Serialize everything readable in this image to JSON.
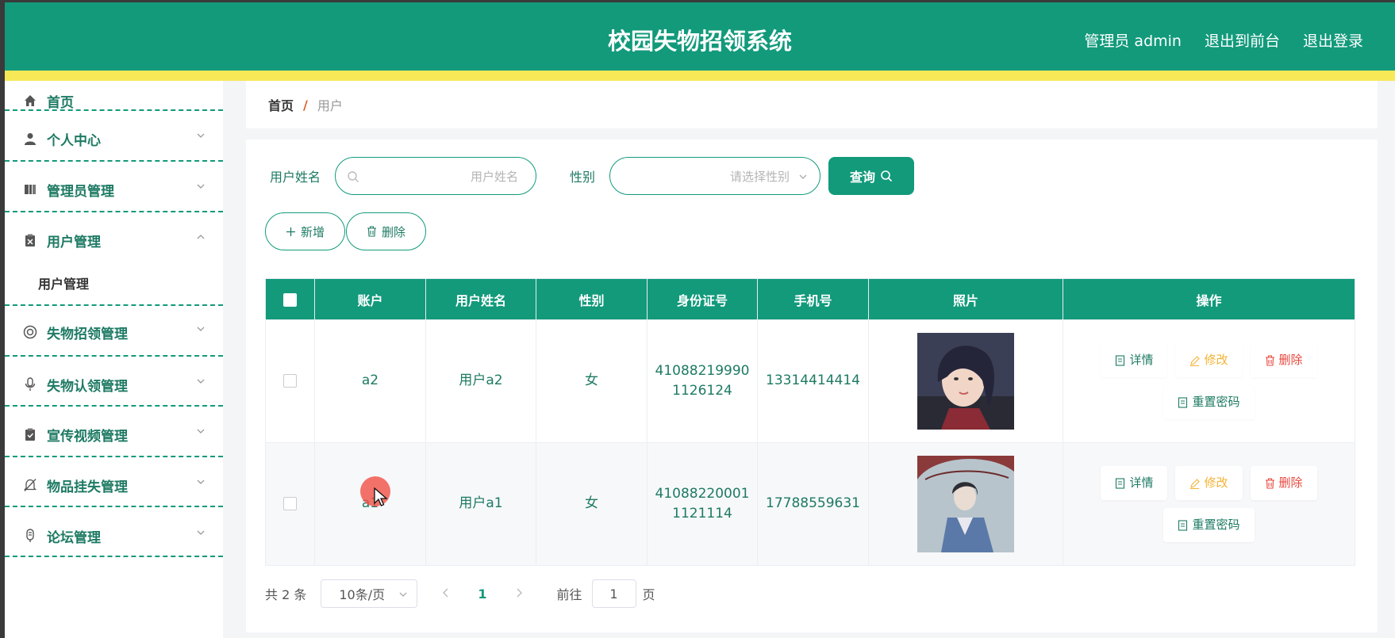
{
  "header": {
    "title": "校园失物招领系统",
    "admin_label": "管理员 admin",
    "to_front": "退出到前台",
    "logout": "退出登录"
  },
  "sidebar": {
    "items": [
      {
        "label": "首页",
        "icon": "home-icon"
      },
      {
        "label": "个人中心",
        "icon": "user-icon"
      },
      {
        "label": "管理员管理",
        "icon": "book-icon"
      },
      {
        "label": "用户管理",
        "icon": "clipboard-icon",
        "expanded": true
      },
      {
        "label": "失物招领管理",
        "icon": "lifebuoy-icon"
      },
      {
        "label": "失物认领管理",
        "icon": "microphone-icon"
      },
      {
        "label": "宣传视频管理",
        "icon": "clipboard-check-icon"
      },
      {
        "label": "物品挂失管理",
        "icon": "bell-off-icon"
      },
      {
        "label": "论坛管理",
        "icon": "mic-icon"
      }
    ],
    "subitem": "用户管理"
  },
  "breadcrumb": {
    "home": "首页",
    "sep": "/",
    "current": "用户"
  },
  "search": {
    "name_label": "用户姓名",
    "name_placeholder": "用户姓名",
    "gender_label": "性别",
    "gender_placeholder": "请选择性别",
    "query_button": "查询"
  },
  "actions": {
    "add": "新增",
    "delete": "删除"
  },
  "table": {
    "columns": [
      "账户",
      "用户姓名",
      "性别",
      "身份证号",
      "手机号",
      "照片",
      "操作"
    ],
    "rows": [
      {
        "account": "a2",
        "name": "用户a2",
        "gender": "女",
        "id_line1": "41088219990",
        "id_line2": "1126124",
        "phone": "13314414414"
      },
      {
        "account": "a1",
        "name": "用户a1",
        "gender": "女",
        "id_line1": "41088220001",
        "id_line2": "1121114",
        "phone": "17788559631"
      }
    ],
    "ops": {
      "detail": "详情",
      "edit": "修改",
      "delete": "删除",
      "reset": "重置密码"
    }
  },
  "pagination": {
    "total": "共 2 条",
    "page_size": "10条/页",
    "current_page": "1",
    "goto_label": "前往",
    "goto_value": "1",
    "goto_suffix": "页"
  },
  "colors": {
    "primary": "#129a7b",
    "stripe": "#f7e858",
    "edit": "#f5b335",
    "danger": "#e8473d"
  }
}
